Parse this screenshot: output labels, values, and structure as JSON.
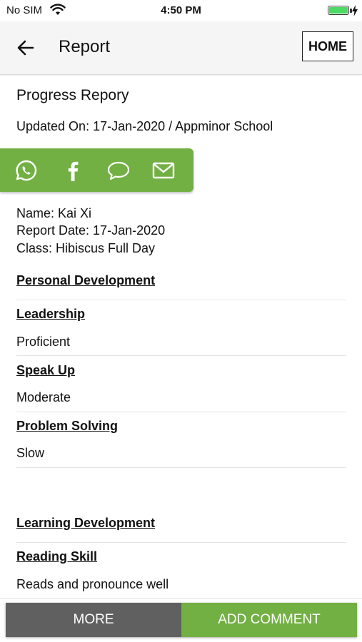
{
  "status": {
    "carrier": "No SIM",
    "time": "4:50 PM",
    "battery_level": 1.0
  },
  "appbar": {
    "title": "Report",
    "home_label": "HOME"
  },
  "report": {
    "heading": "Progress Repory",
    "updated": "Updated On: 17-Jan-2020 / Appminor School",
    "name": "Name: Kai Xi",
    "report_date": "Report Date: 17-Jan-2020",
    "class": "Class: Hibiscus Full Day"
  },
  "share": {
    "color": "#72b043",
    "icons": [
      "whatsapp-icon",
      "facebook-icon",
      "message-icon",
      "mail-icon"
    ]
  },
  "sections": {
    "personal": {
      "title": "Personal Development",
      "items": [
        {
          "label": "Leadership",
          "value": "Proficient"
        },
        {
          "label": "Speak Up",
          "value": "Moderate"
        },
        {
          "label": "Problem Solving",
          "value": "Slow"
        }
      ]
    },
    "learning": {
      "title": "Learning Development",
      "items": [
        {
          "label": "Reading Skill",
          "value": "Reads and pronounce well"
        }
      ]
    }
  },
  "bottom": {
    "more_label": "MORE",
    "add_label": "ADD COMMENT",
    "more_color": "#606060",
    "add_color": "#72b043"
  }
}
